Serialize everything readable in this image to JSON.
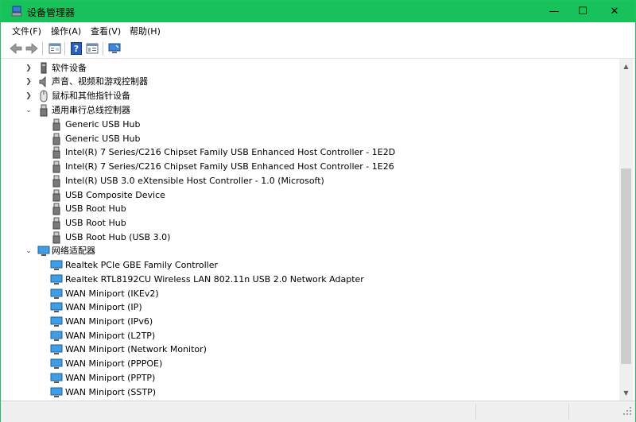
{
  "window": {
    "title": "设备管理器",
    "controls": {
      "minimize": "—",
      "maximize": "☐",
      "close": "✕"
    },
    "accent_color": "#17c25a"
  },
  "menu": [
    {
      "label": "文件(F)"
    },
    {
      "label": "操作(A)"
    },
    {
      "label": "查看(V)"
    },
    {
      "label": "帮助(H)"
    }
  ],
  "toolbar": {
    "buttons": [
      {
        "icon": "back-arrow-icon"
      },
      {
        "icon": "forward-arrow-icon"
      },
      {
        "icon": "properties-icon"
      },
      {
        "icon": "help-icon"
      },
      {
        "icon": "device-view-icon"
      },
      {
        "icon": "monitor-scan-icon"
      }
    ]
  },
  "tree": {
    "categories": [
      {
        "label": "软件设备",
        "expanded": false,
        "icon": "software-device-icon"
      },
      {
        "label": "声音、视频和游戏控制器",
        "expanded": false,
        "icon": "speaker-icon"
      },
      {
        "label": "鼠标和其他指针设备",
        "expanded": false,
        "icon": "mouse-icon"
      },
      {
        "label": "通用串行总线控制器",
        "expanded": true,
        "icon": "usb-icon",
        "children": [
          "Generic USB Hub",
          "Generic USB Hub",
          "Intel(R) 7 Series/C216 Chipset Family USB Enhanced Host Controller - 1E2D",
          "Intel(R) 7 Series/C216 Chipset Family USB Enhanced Host Controller - 1E26",
          "Intel(R) USB 3.0 eXtensible Host Controller - 1.0 (Microsoft)",
          "USB Composite Device",
          "USB Root Hub",
          "USB Root Hub",
          "USB Root Hub (USB 3.0)"
        ]
      },
      {
        "label": "网络适配器",
        "expanded": true,
        "icon": "network-adapter-icon",
        "children": [
          "Realtek PCIe GBE Family Controller",
          "Realtek RTL8192CU Wireless LAN 802.11n USB 2.0 Network Adapter",
          "WAN Miniport (IKEv2)",
          "WAN Miniport (IP)",
          "WAN Miniport (IPv6)",
          "WAN Miniport (L2TP)",
          "WAN Miniport (Network Monitor)",
          "WAN Miniport (PPPOE)",
          "WAN Miniport (PPTP)",
          "WAN Miniport (SSTP)"
        ]
      }
    ]
  },
  "scrollbar": {
    "up": "▲",
    "down": "▼"
  }
}
